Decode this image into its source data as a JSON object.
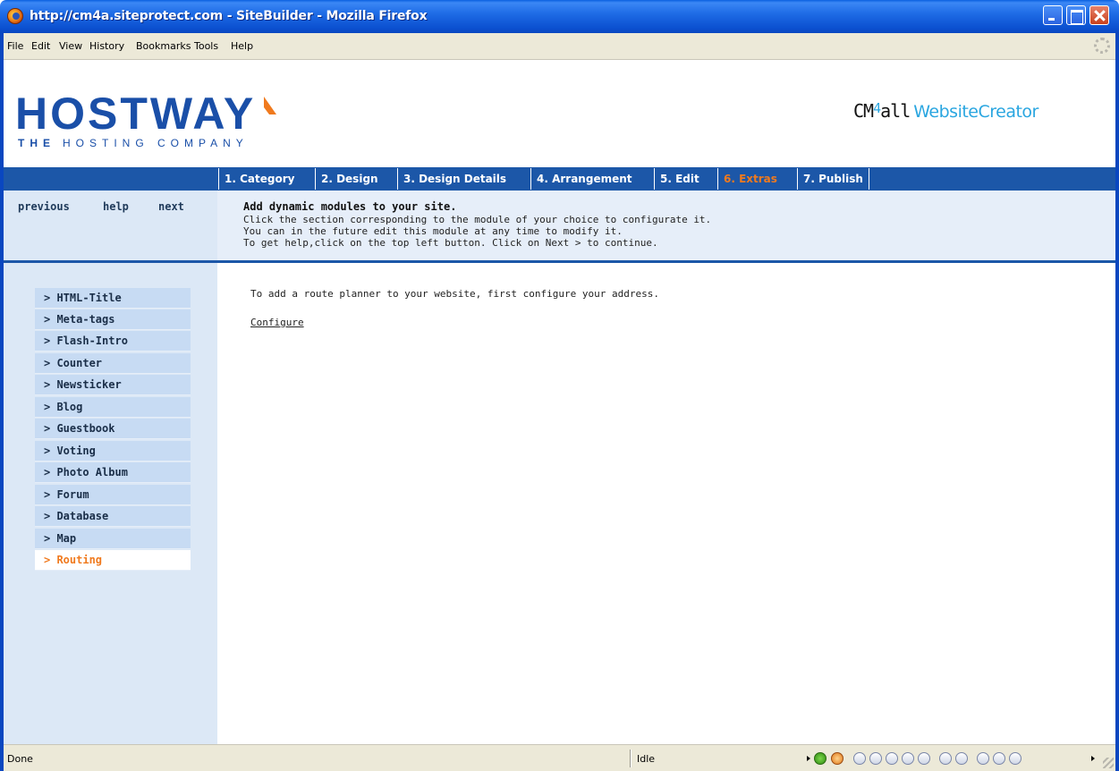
{
  "window": {
    "title": "http://cm4a.siteprotect.com - SiteBuilder - Mozilla Firefox"
  },
  "menu": {
    "items": [
      "File",
      "Edit",
      "View",
      "History",
      "Bookmarks",
      "Tools",
      "Help"
    ]
  },
  "header": {
    "brand_main": "HOSTWAY",
    "brand_tagline": "THE HOSTING COMPANY",
    "brand_tagline_bold": "THE",
    "brand_tagline_rest": "HOSTING COMPANY",
    "cm_prefix": "CM",
    "cm_four": "4",
    "cm_all": "all",
    "cm_product": "WebsiteCreator"
  },
  "tabs": [
    {
      "label": "1. Category"
    },
    {
      "label": "2. Design"
    },
    {
      "label": "3. Design Details"
    },
    {
      "label": "4. Arrangement"
    },
    {
      "label": "5. Edit"
    },
    {
      "label": "6. Extras",
      "active": true
    },
    {
      "label": "7. Publish"
    }
  ],
  "nav": {
    "previous": "previous",
    "help": "help",
    "next": "next"
  },
  "instructions": {
    "title": "Add dynamic modules to your site.",
    "line1": "Click the section corresponding to the module of your choice to configurate it.",
    "line2": "You can in the future edit this module at any time to modify it.",
    "line3": "To get help,click on the top left button. Click on Next > to continue."
  },
  "sidebar": {
    "items": [
      {
        "label": "> HTML-Title"
      },
      {
        "label": "> Meta-tags"
      },
      {
        "label": "> Flash-Intro"
      },
      {
        "label": "> Counter"
      },
      {
        "label": "> Newsticker"
      },
      {
        "label": "> Blog"
      },
      {
        "label": "> Guestbook"
      },
      {
        "label": "> Voting"
      },
      {
        "label": "> Photo Album"
      },
      {
        "label": "> Forum"
      },
      {
        "label": "> Database"
      },
      {
        "label": "> Map"
      },
      {
        "label": "> Routing",
        "active": true
      }
    ]
  },
  "main": {
    "text": "To add a route planner to your website, first configure your address.",
    "configure_link": "Configure"
  },
  "status": {
    "left": "Done",
    "middle": "Idle"
  },
  "colors": {
    "tab_bar": "#1c57a8",
    "active_orange": "#f07a1e",
    "panel_blue": "#dce8f6",
    "sidebar_item": "#c7dbf3",
    "cm4all_blue": "#2aa6e0"
  }
}
